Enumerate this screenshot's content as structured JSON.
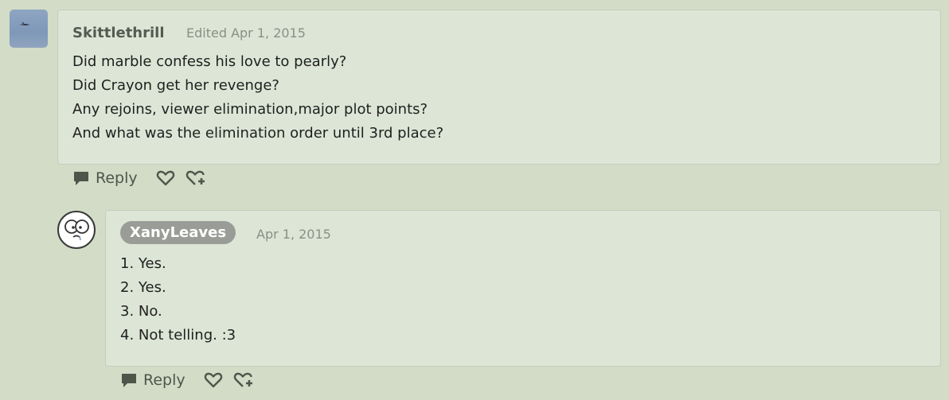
{
  "comments": [
    {
      "author": "Skittlethrill",
      "timestamp": "Edited Apr 1, 2015",
      "avatar_icon": "bird-in-sky-avatar",
      "lines": [
        "Did marble confess his love to pearly?",
        "Did Crayon get her revenge?",
        "Any rejoins, viewer elimination,major plot points?",
        "And what was the elimination order until 3rd place?"
      ],
      "actions": {
        "reply_label": "Reply"
      }
    },
    {
      "author": "XanyLeaves",
      "timestamp": "Apr 1, 2015",
      "avatar_icon": "cartoon-face-avatar",
      "lines": [
        "1. Yes.",
        "2. Yes.",
        "3. No.",
        "4. Not telling. :3"
      ],
      "actions": {
        "reply_label": "Reply"
      }
    }
  ],
  "colors": {
    "page_background": "#d2dcc7",
    "card_background": "#dde6d6",
    "author_pill": "#9a9d97",
    "action_icons": "#4f554b"
  }
}
